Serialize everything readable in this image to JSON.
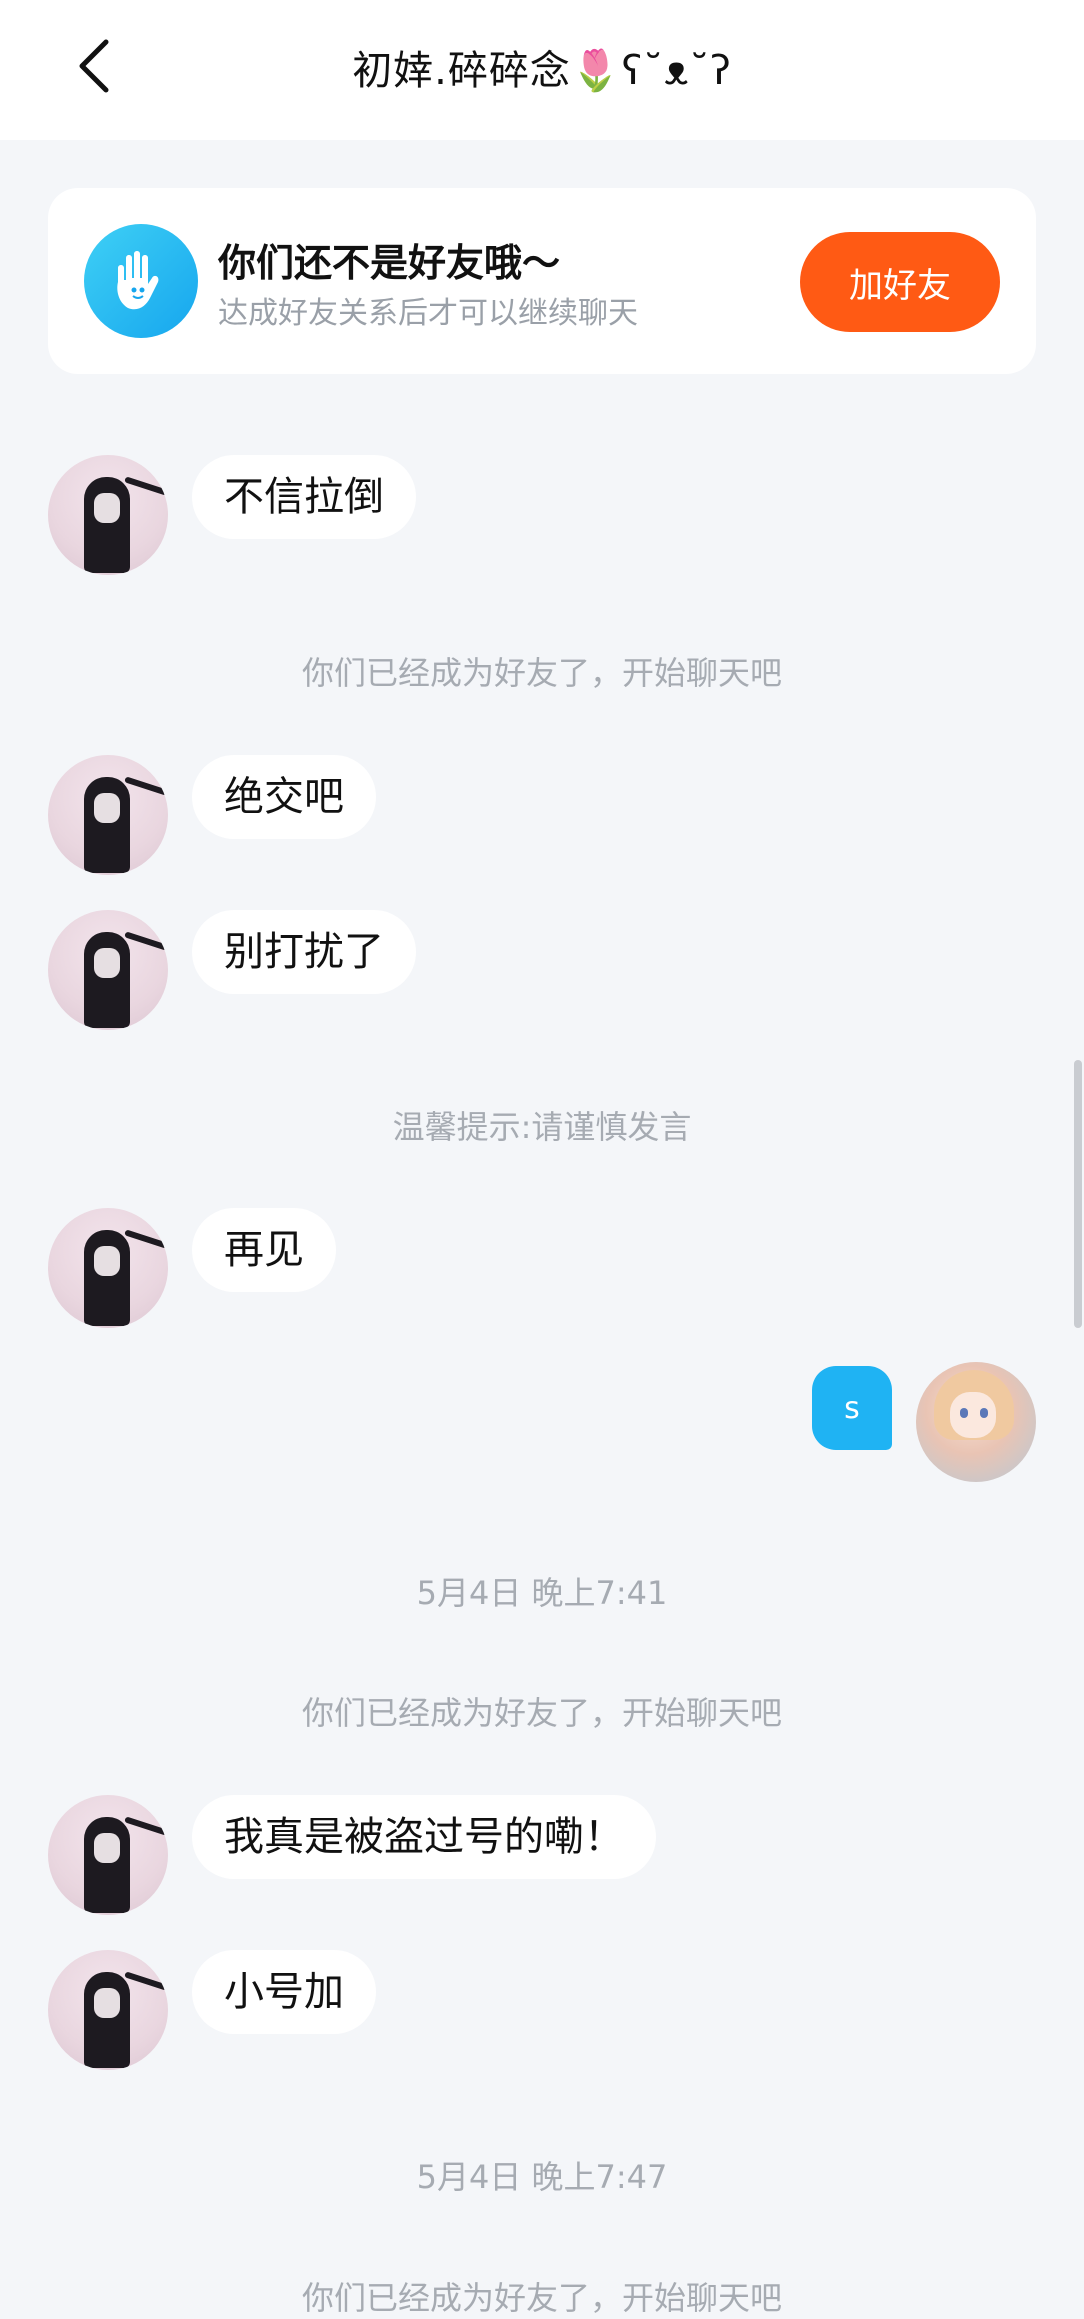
{
  "header": {
    "title": "初婞.碎碎念🌷ʕ˘ᴥ˘ʔ",
    "back_icon": "chevron-left-icon"
  },
  "banner": {
    "title": "你们还不是好友哦～",
    "subtitle": "达成好友关系后才可以继续聊天",
    "button_label": "加好友",
    "button_color": "#ff5a14",
    "icon": "hand-wave-icon"
  },
  "messages": [
    {
      "type": "left",
      "text": "不信拉倒"
    },
    {
      "type": "note",
      "text": "你们已经成为好友了，开始聊天吧"
    },
    {
      "type": "left",
      "text": "绝交吧"
    },
    {
      "type": "left",
      "text": "别打扰了"
    },
    {
      "type": "note",
      "text": "温馨提示:请谨慎发言"
    },
    {
      "type": "left",
      "text": "再见"
    },
    {
      "type": "right",
      "text": "s"
    },
    {
      "type": "time",
      "text": "5月4日 晚上7:41"
    },
    {
      "type": "note",
      "text": "你们已经成为好友了，开始聊天吧"
    },
    {
      "type": "left",
      "text": "我真是被盗过号的嘞！"
    },
    {
      "type": "left",
      "text": "小号加"
    },
    {
      "type": "time",
      "text": "5月4日 晚上7:47"
    },
    {
      "type": "note",
      "text": "你们已经成为好友了，开始聊天吧"
    }
  ],
  "colors": {
    "background": "#f4f6f9",
    "self_bubble": "#1fb3f3",
    "accent": "#ff5a14"
  }
}
